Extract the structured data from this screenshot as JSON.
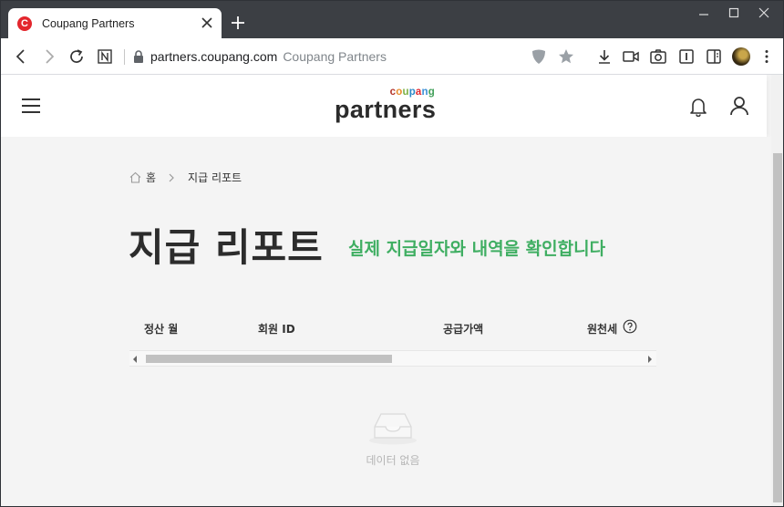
{
  "browser": {
    "tab": {
      "favicon_letter": "C",
      "title": "Coupang Partners"
    },
    "address": {
      "url": "partners.coupang.com",
      "page_title": "Coupang Partners"
    },
    "window_controls": [
      "minimize",
      "maximize",
      "close"
    ]
  },
  "header": {
    "logo_top": "coupang",
    "logo_main": "partners",
    "logo_top_colors": [
      "#b5362a",
      "#e88c2a",
      "#7bb043",
      "#2b8ac9",
      "#e3262d",
      "#3a8fd6",
      "#42a05a"
    ]
  },
  "breadcrumb": {
    "home": "홈",
    "current": "지급 리포트"
  },
  "main": {
    "title": "지급 리포트",
    "subtitle": "실제 지급일자와 내역을 확인합니다",
    "table": {
      "columns": [
        "정산 월",
        "회원 ID",
        "공급가액",
        "원천세"
      ]
    },
    "empty_text": "데이터 없음"
  },
  "colors": {
    "accent_green": "#3fae62",
    "favicon_red": "#e3262d"
  }
}
